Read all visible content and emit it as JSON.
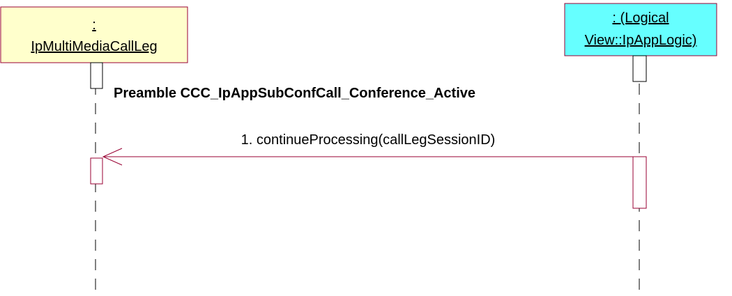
{
  "participants": [
    {
      "line1": ":",
      "line2": "IpMultiMediaCallLeg",
      "fill": "#ffffcc",
      "border": "#990033"
    },
    {
      "line1": ": (Logical",
      "line2": "View::IpAppLogic)",
      "fill": "#66ffff",
      "border": "#990033"
    }
  ],
  "note": {
    "text": "Preamble CCC_IpAppSubConfCall_Conference_Active"
  },
  "messages": [
    {
      "label": "1. continueProcessing(callLegSessionID)",
      "color": "#990033"
    }
  ],
  "colors": {
    "lifeline": "#000000",
    "activation_border": "#990033",
    "activation_fill": "#ffffff"
  }
}
